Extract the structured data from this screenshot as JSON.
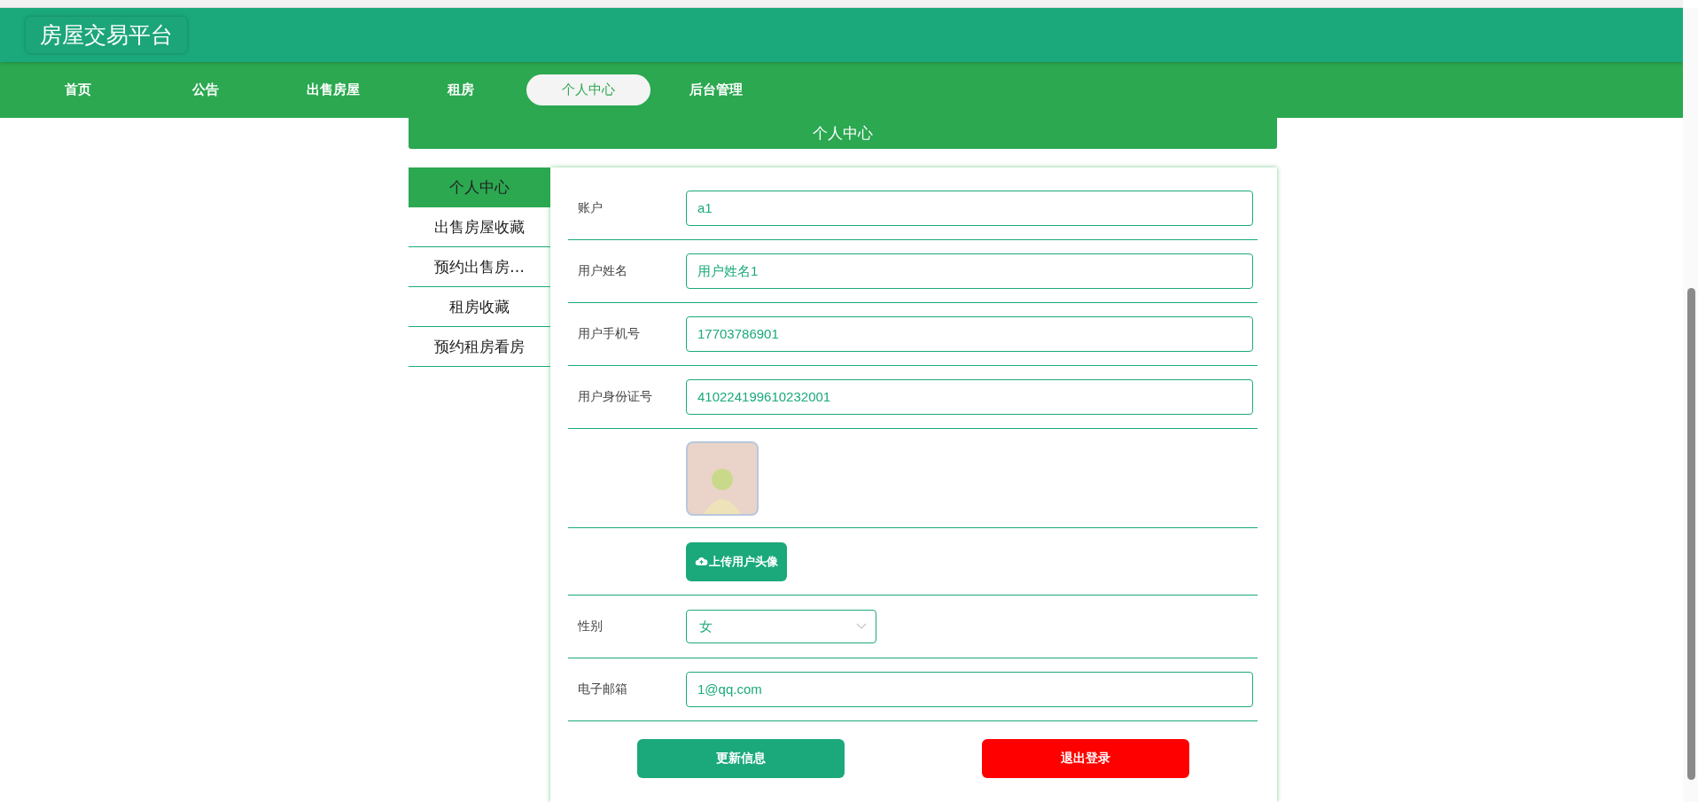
{
  "header": {
    "title": "房屋交易平台"
  },
  "nav": [
    {
      "label": "首页",
      "selected": false
    },
    {
      "label": "公告",
      "selected": false
    },
    {
      "label": "出售房屋",
      "selected": false
    },
    {
      "label": "租房",
      "selected": false
    },
    {
      "label": "个人中心",
      "selected": true
    },
    {
      "label": "后台管理",
      "selected": false
    }
  ],
  "section_title": "个人中心",
  "side_menu": [
    {
      "label": "个人中心",
      "selected": true
    },
    {
      "label": "出售房屋收藏",
      "selected": false
    },
    {
      "label": "预约出售房…",
      "selected": false
    },
    {
      "label": "租房收藏",
      "selected": false
    },
    {
      "label": "预约租房看房",
      "selected": false
    }
  ],
  "form": [
    {
      "kind": "text",
      "label": "账户",
      "value": "a1"
    },
    {
      "kind": "text",
      "label": "用户姓名",
      "value": "用户姓名1"
    },
    {
      "kind": "text",
      "label": "用户手机号",
      "value": "17703786901"
    },
    {
      "kind": "text",
      "label": "用户身份证号",
      "value": "410224199610232001"
    },
    {
      "kind": "avatar"
    },
    {
      "kind": "upload",
      "button": "上传用户头像"
    },
    {
      "kind": "select",
      "label": "性别",
      "value": "女"
    },
    {
      "kind": "text",
      "label": "电子邮箱",
      "value": "1@qq.com"
    }
  ],
  "buttons": [
    {
      "kind": "primary",
      "label": "更新信息"
    },
    {
      "kind": "danger",
      "label": "退出登录"
    }
  ]
}
